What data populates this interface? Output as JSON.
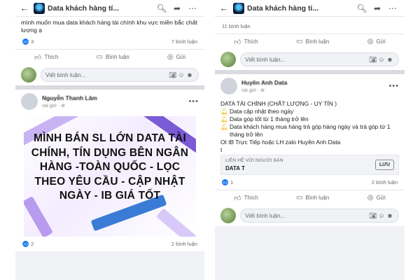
{
  "left": {
    "header": {
      "title": "Data khách hàng tí..."
    },
    "comment": {
      "text": "mình muốn mua data khách hàng tài chính khu vực miền bắc chất lượng ạ"
    },
    "comment_stats": {
      "likes": "3",
      "comments": "7 bình luận"
    },
    "actions": {
      "like": "Thích",
      "comment": "Bình luận",
      "send": "Gửi"
    },
    "composer": {
      "placeholder": "Viết bình luận..."
    },
    "post": {
      "author": "Nguyễn Thanh Lâm",
      "time": "vài giờ · ⊕",
      "banner_text": "MÌNH BÁN SL LỚN DATA TÀI CHÍNH, TÍN DỤNG BÊN NGÂN HÀNG -TOÀN QUỐC - LỌC THEO YÊU CẦU - CẬP NHẬT NGÀY - IB GIÁ TỐT"
    },
    "post_stats": {
      "likes": "2",
      "comments": "2 bình luận"
    }
  },
  "right": {
    "header": {
      "title": "Data khách hàng ti..."
    },
    "top_stats": {
      "comments": "11 bình luận"
    },
    "actions": {
      "like": "Thích",
      "comment": "Bình luận",
      "send": "Gửi"
    },
    "composer": {
      "placeholder": "Viết bình luận..."
    },
    "post": {
      "author": "Huyền Anh Data",
      "time": "vài giờ · ⊕",
      "lines": {
        "title": "DATA TÀI CHÍNH (CHẤT LƯỢNG - UY TÍN )",
        "b1": "Data cập nhật theo ngày",
        "b2": "Data góp tốt từ 1 tháng trở lên",
        "b3": "Data khách hàng mua hàng trả góp hàng ngày và trả góp từ 1 tháng trở lên",
        "contact": "Ot IB Trực Tiếp hoặc LH zalo Huyền Anh Data",
        "cut": "t"
      },
      "cta": {
        "label": "LIÊN HỆ VỚI NGƯỜI BÁN",
        "title": "DATA T",
        "save": "LƯU"
      }
    },
    "post_stats": {
      "likes": "1",
      "comments": "2 bình luận"
    },
    "composer2": {
      "placeholder": "Viết bình luận..."
    }
  },
  "icons": {
    "back": "arrow-left",
    "search": "magnifier",
    "share": "share-arrow",
    "more": "ellipsis",
    "like": "thumbs-up",
    "comment": "speech-bubble",
    "send": "messenger",
    "camera": "camera",
    "emoji": "smiley",
    "sticker": "sticker",
    "announcement": "bell"
  },
  "colors": {
    "accent": "#1877f2",
    "banner_purple": "#7b5ad6",
    "bell": "#f2b600"
  }
}
